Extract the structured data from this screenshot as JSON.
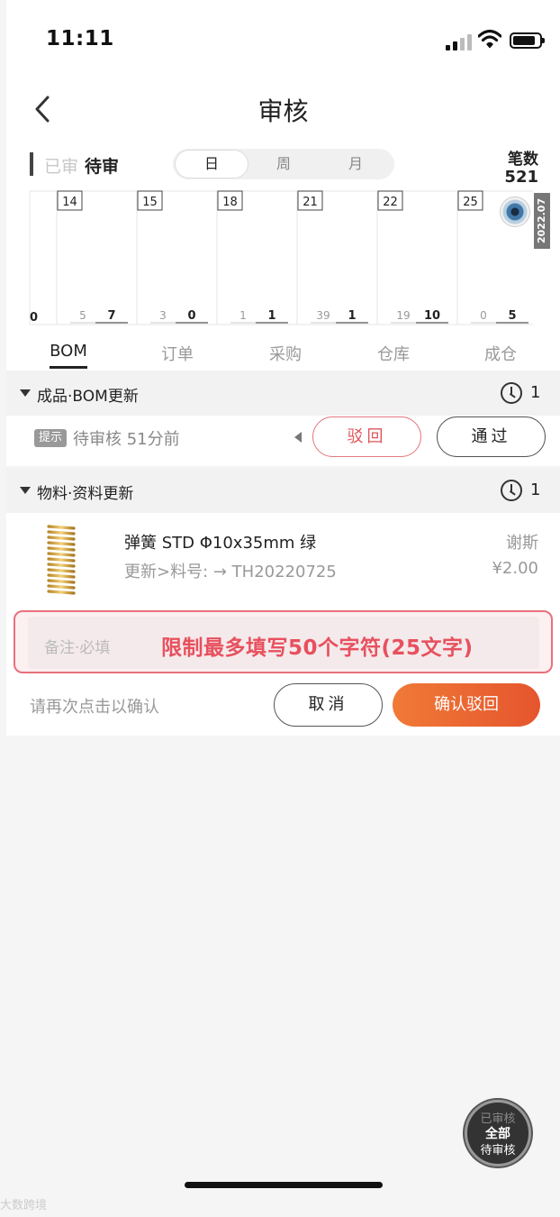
{
  "status_bar": {
    "time": "11:11"
  },
  "nav": {
    "title": "审核"
  },
  "filter": {
    "reviewed_label": "已审",
    "pending_label": "待审",
    "period_options": [
      "日",
      "周",
      "月"
    ],
    "active_period": "日",
    "count_label": "笔数",
    "count_value": "521"
  },
  "chart_data": {
    "type": "bar",
    "date_labels": [
      "14",
      "15",
      "18",
      "21",
      "22",
      "25"
    ],
    "series": [
      {
        "values": [
          5,
          3,
          1,
          39,
          19,
          0
        ]
      },
      {
        "values": [
          7,
          0,
          1,
          1,
          10,
          5
        ]
      }
    ],
    "leading_partial_value": "0",
    "year_tag": "2022.07",
    "icon": "eye-icon"
  },
  "tabs": [
    "BOM",
    "订单",
    "采购",
    "仓库",
    "成仓"
  ],
  "active_tab": "BOM",
  "section_bom": {
    "title": "成品·BOM更新",
    "count": "1"
  },
  "bom_row": {
    "hint_badge": "提示",
    "status": "待审核 51分前",
    "reject_label": "驳回",
    "pass_label": "通过"
  },
  "section_material": {
    "title": "物料·资料更新",
    "count": "1"
  },
  "material_item": {
    "name": "弹簧 STD Φ10x35mm 绿",
    "update": "更新>料号:   → TH20220725",
    "author": "谢斯",
    "price": "¥2.00",
    "image_icon": "spring-icon"
  },
  "note": {
    "placeholder": "备注·必填",
    "warning": "限制最多填写50个字符(25文字)"
  },
  "confirm": {
    "prompt": "请再次点击以确认",
    "cancel_label": "取消",
    "confirm_label": "确认驳回"
  },
  "fab": {
    "line1": "已审核",
    "line2": "全部",
    "line3": "待审核"
  },
  "watermark": "大数跨境",
  "colors": {
    "accent_red": "#e8505e",
    "confirm_orange": "#ec6632"
  }
}
